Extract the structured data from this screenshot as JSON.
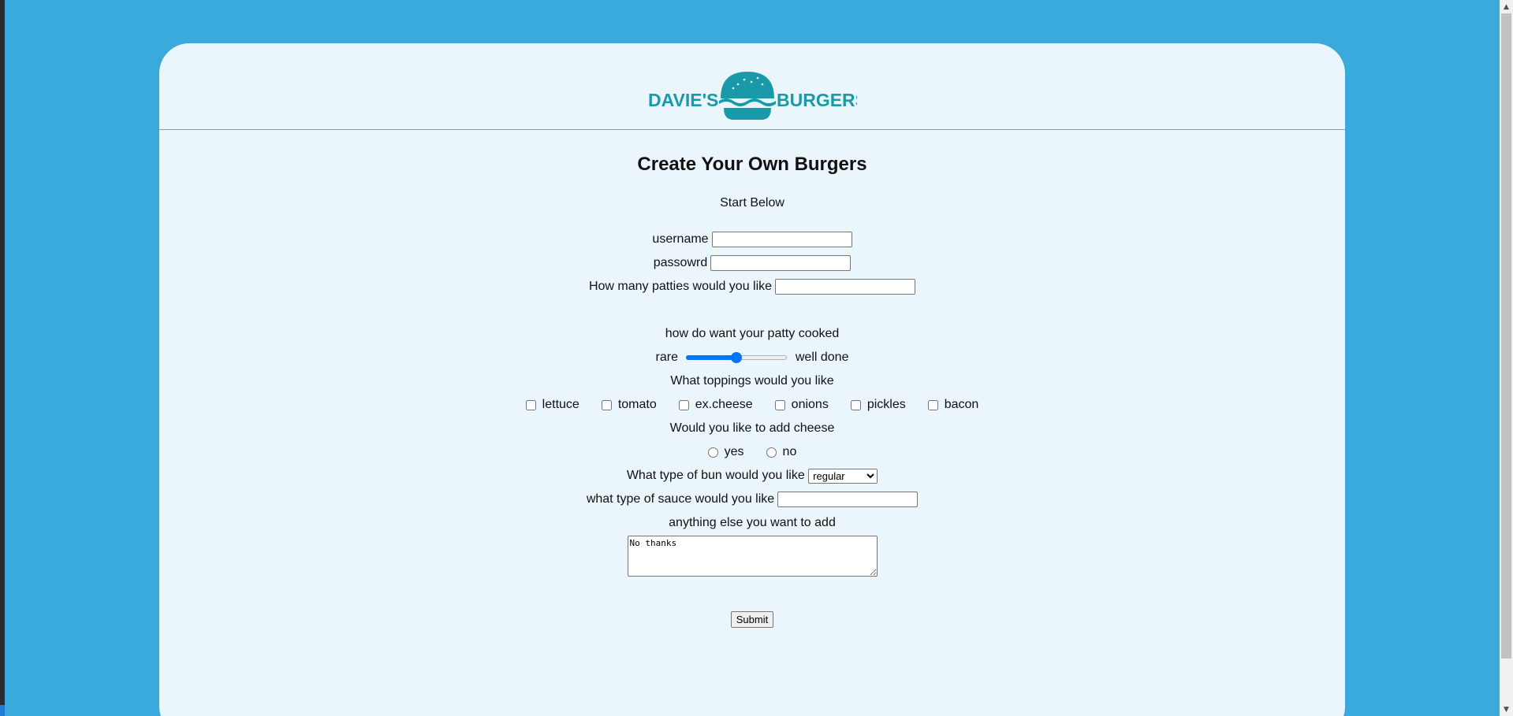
{
  "brand": {
    "name_left": "DAVIE'S",
    "name_right": "BURGERS",
    "color": "#1a9aa8"
  },
  "colors": {
    "page_background": "#3aa9dc",
    "card_background": "#eaf6fb",
    "accent": "#0075ff"
  },
  "form": {
    "title": "Create Your Own Burgers",
    "subtitle": "Start Below",
    "username_label": "username",
    "username_value": "",
    "password_label": "passowrd",
    "password_value": "",
    "patties_label": "How many patties would you like",
    "patties_value": "",
    "cook_label": "how do want your patty cooked",
    "cook_min_label": "rare",
    "cook_max_label": "well done",
    "cook_level": 0.5,
    "toppings_label": "What toppings would you like",
    "toppings": [
      "lettuce",
      "tomato",
      "ex.cheese",
      "onions",
      "pickles",
      "bacon"
    ],
    "cheese_label": "Would you like to add cheese",
    "cheese_yes": "yes",
    "cheese_no": "no",
    "bun_label": "What type of bun would you like",
    "bun_selected": "regular",
    "sauce_label": "what type of sauce would you like",
    "sauce_value": "",
    "extra_label": "anything else you want to add",
    "extra_value": "No thanks",
    "submit_label": "Submit"
  }
}
